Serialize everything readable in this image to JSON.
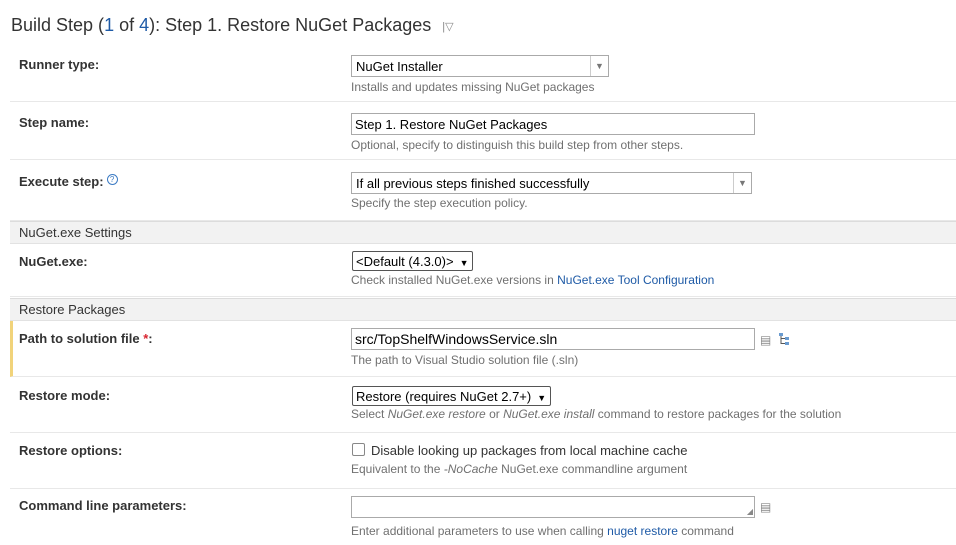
{
  "header": {
    "title_prefix": "Build Step (",
    "step_current": "1",
    "title_of": " of ",
    "step_total": "4",
    "title_suffix": "): Step 1. Restore NuGet Packages",
    "dropdown_icon": "chevron-down-icon"
  },
  "runner_type": {
    "label": "Runner type:",
    "value": "NuGet Installer",
    "note": "Installs and updates missing NuGet packages"
  },
  "step_name": {
    "label": "Step name:",
    "value": "Step 1. Restore NuGet Packages",
    "note": "Optional, specify to distinguish this build step from other steps."
  },
  "execute_step": {
    "label": "Execute step:",
    "value": "If all previous steps finished successfully",
    "note": "Specify the step execution policy.",
    "help_icon": "?"
  },
  "section_nuget": "NuGet.exe Settings",
  "nuget_exe": {
    "label": "NuGet.exe:",
    "value": "<Default (4.3.0)>",
    "note_prefix": "Check installed NuGet.exe versions in ",
    "note_link": "NuGet.exe Tool Configuration"
  },
  "section_restore": "Restore Packages",
  "solution_path": {
    "label": "Path to solution file",
    "required_mark": " *",
    "colon": ":",
    "value": "src/TopShelfWindowsService.sln",
    "note": "The path to Visual Studio solution file (.sln)"
  },
  "restore_mode": {
    "label": "Restore mode:",
    "value": "Restore (requires NuGet 2.7+)",
    "note_prefix": "Select ",
    "note_em1": "NuGet.exe restore",
    "note_mid": " or ",
    "note_em2": "NuGet.exe install",
    "note_suffix": " command to restore packages for the solution"
  },
  "restore_options": {
    "label": "Restore options:",
    "checkbox_label": "Disable looking up packages from local machine cache",
    "checked": false,
    "note_prefix": "Equivalent to the ",
    "note_em": "-NoCache",
    "note_suffix": " NuGet.exe commandline argument"
  },
  "command_line": {
    "label": "Command line parameters:",
    "value": "",
    "note_prefix": "Enter additional parameters to use when calling ",
    "note_link": "nuget restore",
    "note_suffix": " command"
  },
  "colors": {
    "link": "#1e5aa6",
    "required": "#d9232e",
    "highlight_border": "#f1d37a",
    "section_bg": "#f2f2f2"
  }
}
